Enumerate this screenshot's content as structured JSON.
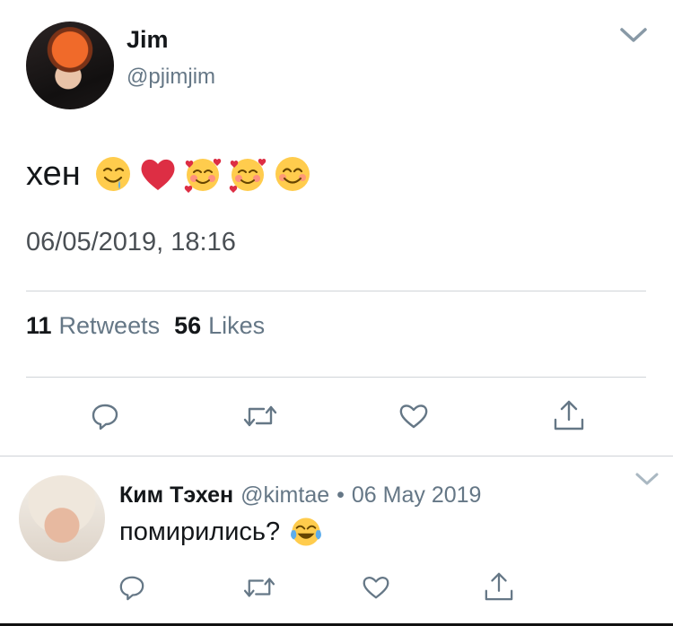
{
  "tweet": {
    "author_name": "Jim",
    "author_handle": "@pjimjim",
    "text": "хен",
    "emojis": [
      "drooling-face-emoji",
      "red-heart-emoji",
      "smiling-face-with-hearts-emoji",
      "smiling-face-with-hearts-emoji",
      "smiling-face-with-smiling-eyes-emoji"
    ],
    "timestamp": "06/05/2019, 18:16",
    "retweets_count": "11",
    "retweets_label": "Retweets",
    "likes_count": "56",
    "likes_label": "Likes"
  },
  "reply": {
    "author_name": "Ким Тэхен",
    "author_handle": "@kimtae",
    "separator": "•",
    "date": "06 May 2019",
    "text": "помирились?",
    "emoji": "face-with-tears-of-joy-emoji"
  },
  "actions": [
    "reply-icon",
    "retweet-icon",
    "like-icon",
    "share-icon"
  ],
  "colors": {
    "text_primary": "#14171a",
    "text_secondary": "#657786",
    "divider": "#d0d4d8",
    "icon": "#657786"
  }
}
